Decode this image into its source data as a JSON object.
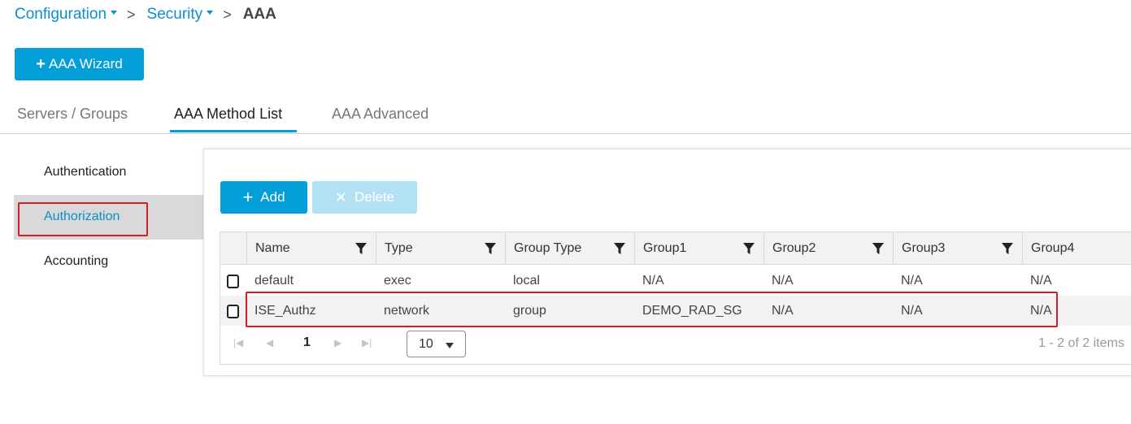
{
  "breadcrumb": {
    "items": [
      "Configuration",
      "Security"
    ],
    "current": "AAA",
    "separator": ">"
  },
  "wizard_button": {
    "label": "AAA Wizard"
  },
  "tabs": [
    {
      "label": "Servers / Groups",
      "active": false
    },
    {
      "label": "AAA Method List",
      "active": true
    },
    {
      "label": "AAA Advanced",
      "active": false
    }
  ],
  "sidenav": {
    "items": [
      {
        "label": "Authentication",
        "active": false
      },
      {
        "label": "Authorization",
        "active": true
      },
      {
        "label": "Accounting",
        "active": false
      }
    ]
  },
  "actions": {
    "add_label": "Add",
    "delete_label": "Delete",
    "delete_enabled": false
  },
  "table": {
    "columns": [
      "Name",
      "Type",
      "Group Type",
      "Group1",
      "Group2",
      "Group3",
      "Group4"
    ],
    "rows": [
      [
        "default",
        "exec",
        "local",
        "N/A",
        "N/A",
        "N/A",
        "N/A"
      ],
      [
        "ISE_Authz",
        "network",
        "group",
        "DEMO_RAD_SG",
        "N/A",
        "N/A",
        "N/A"
      ]
    ],
    "highlighted_row": 1
  },
  "pager": {
    "current_page": "1",
    "page_size": "10",
    "info": "1 - 2 of 2 items"
  },
  "colors": {
    "accent": "#049fd9",
    "link": "#0b8fd1",
    "highlight_box": "#d11f27",
    "disabled_button": "#b3e1f4"
  }
}
